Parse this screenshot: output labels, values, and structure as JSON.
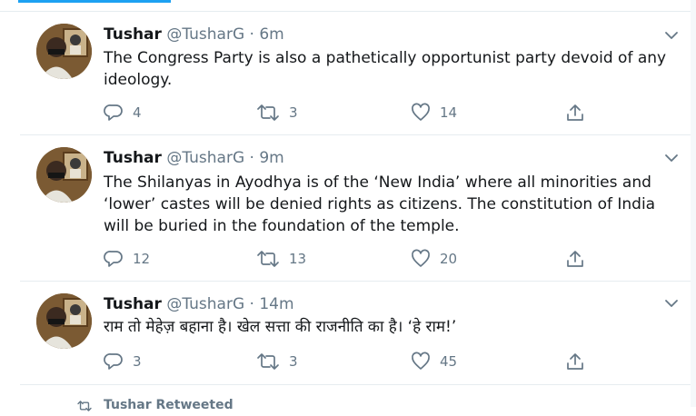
{
  "colors": {
    "accent": "#1da1f2",
    "secondary_text": "#657786",
    "border": "#e6ecf0"
  },
  "tweets": [
    {
      "name": "Tushar",
      "handle": "@TusharG",
      "separator": "·",
      "time": "6m",
      "text": "The Congress Party is also a pathetically opportunist party devoid of any ideology.",
      "replies": "4",
      "retweets": "3",
      "likes": "14"
    },
    {
      "name": "Tushar",
      "handle": "@TusharG",
      "separator": "·",
      "time": "9m",
      "text": "The Shilanyas in Ayodhya is of the  ‘New India’ where all minorities and ‘lower’ castes will be denied rights as citizens. The constitution of India will be buried in the foundation of the temple.",
      "replies": "12",
      "retweets": "13",
      "likes": "20"
    },
    {
      "name": "Tushar",
      "handle": "@TusharG",
      "separator": "·",
      "time": "14m",
      "text": "राम तो मेहेज़ बहाना है। खेल सत्ता की राजनीति का है। ‘हे राम!’",
      "replies": "3",
      "retweets": "3",
      "likes": "45"
    }
  ],
  "retweet_strip": {
    "label": "Tushar Retweeted",
    "icon": "retweet-icon"
  }
}
